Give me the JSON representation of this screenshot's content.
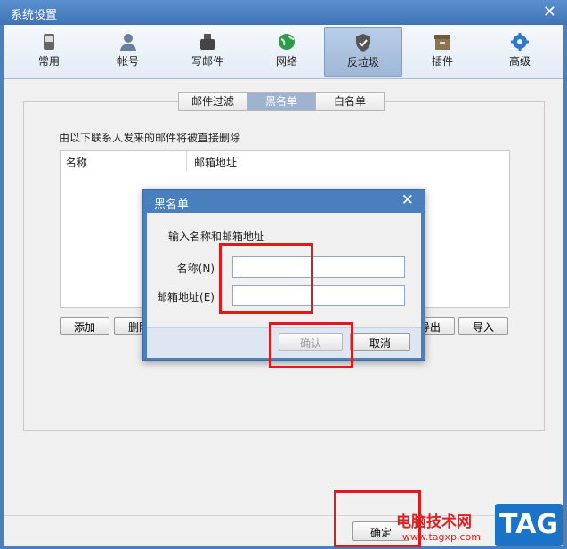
{
  "window": {
    "title": "系统设置",
    "close": "✕"
  },
  "toolbar": [
    {
      "id": "general",
      "label": "常用",
      "icon": "phone-icon"
    },
    {
      "id": "account",
      "label": "帐号",
      "icon": "user-icon"
    },
    {
      "id": "compose",
      "label": "写邮件",
      "icon": "inkwell-icon"
    },
    {
      "id": "network",
      "label": "网络",
      "icon": "globe-icon"
    },
    {
      "id": "antispam",
      "label": "反垃圾",
      "icon": "shield-icon",
      "active": true
    },
    {
      "id": "plugins",
      "label": "插件",
      "icon": "box-icon"
    },
    {
      "id": "advanced",
      "label": "高级",
      "icon": "gear-icon"
    }
  ],
  "subtabs": [
    {
      "label": "邮件过滤",
      "active": false
    },
    {
      "label": "黑名单",
      "active": true
    },
    {
      "label": "白名单",
      "active": false
    }
  ],
  "blacklist": {
    "description": "由以下联系人发来的邮件将被直接删除",
    "columns": [
      "名称",
      "邮箱地址"
    ],
    "buttons": {
      "add": "添加",
      "delete": "删除",
      "export": "导出",
      "import": "导入"
    }
  },
  "dialog": {
    "title": "黑名单",
    "close": "✕",
    "prompt": "输入名称和邮箱地址",
    "name_label": "名称(N)",
    "email_label": "邮箱地址(E)",
    "name_value": "",
    "email_value": "",
    "confirm": "确认",
    "cancel": "取消"
  },
  "footer": {
    "ok": "确定"
  },
  "watermark": {
    "site_name": "电脑技术网",
    "url": "www.tagxp.com",
    "badge": "TAG"
  },
  "colors": {
    "titlebar": "#4a7fbe",
    "highlight": "#e01a1a",
    "active_tab": "#9db3cf"
  }
}
